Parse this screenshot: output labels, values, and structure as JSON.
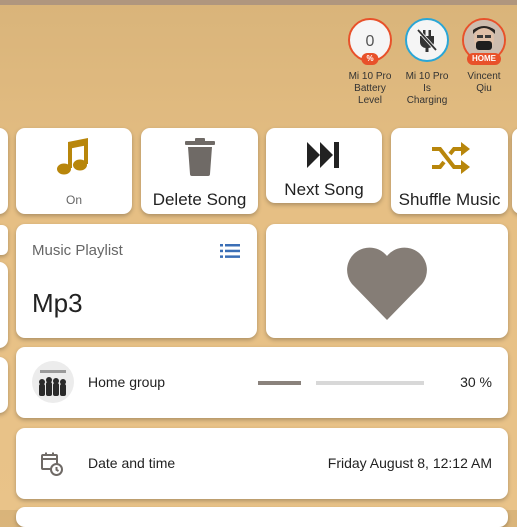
{
  "badges": [
    {
      "value": "0",
      "tag": "%",
      "label_lines": [
        "Mi 10 Pro",
        "Battery",
        "Level"
      ],
      "ring": "#e8512a"
    },
    {
      "tag": "",
      "label_lines": [
        "Mi 10 Pro",
        "Is",
        "Charging"
      ],
      "ring": "#2aa6d6"
    },
    {
      "tag": "HOME",
      "label_lines": [
        "Vincent",
        "Qiu"
      ],
      "ring": "#e8512a"
    }
  ],
  "tiles": {
    "music_on": {
      "state": "On",
      "icon": "music-note-icon"
    },
    "delete": {
      "label": "Delete Song",
      "icon": "trash-icon"
    },
    "next": {
      "label": "Next Song",
      "icon": "skip-next-icon"
    },
    "shuffle": {
      "label": "Shuffle Music",
      "icon": "shuffle-icon"
    }
  },
  "playlist": {
    "title": "Music Playlist",
    "value": "Mp3",
    "icon": "list-icon"
  },
  "favorite": {
    "icon": "heart-icon"
  },
  "home_group": {
    "label": "Home group",
    "volume_text": "30 %",
    "volume": 0.3,
    "icon": "album-art"
  },
  "datetime": {
    "label": "Date and time",
    "value": "Friday August 8, 12:12 AM",
    "icon": "calendar-clock-icon"
  },
  "colors": {
    "accent": "#b8860b",
    "icon_gray": "#6f6a66",
    "heart": "#857d76",
    "list_icon": "#3b6fb6"
  }
}
